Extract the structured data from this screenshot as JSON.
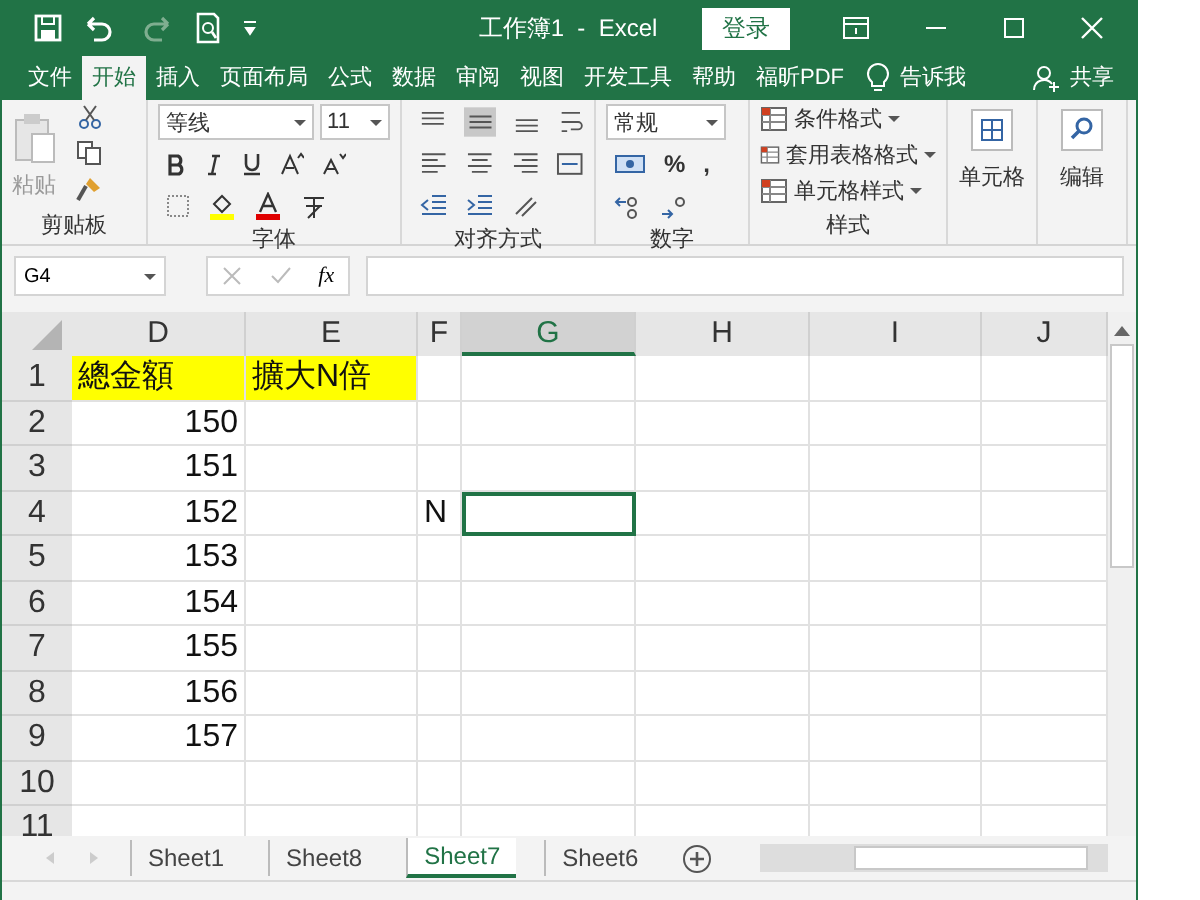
{
  "window": {
    "title": "工作簿1  -  Excel",
    "login": "登录"
  },
  "tabs": [
    {
      "label": "文件",
      "selected": false
    },
    {
      "label": "开始",
      "selected": true
    },
    {
      "label": "插入",
      "selected": false
    },
    {
      "label": "页面布局",
      "selected": false
    },
    {
      "label": "公式",
      "selected": false
    },
    {
      "label": "数据",
      "selected": false
    },
    {
      "label": "审阅",
      "selected": false
    },
    {
      "label": "视图",
      "selected": false
    },
    {
      "label": "开发工具",
      "selected": false
    },
    {
      "label": "帮助",
      "selected": false
    },
    {
      "label": "福昕PDF",
      "selected": false
    },
    {
      "label": "告诉我",
      "selected": false
    }
  ],
  "share": "共享",
  "ribbon": {
    "paste": "粘贴",
    "clipboard_group": "剪贴板",
    "font_name": "等线",
    "font_size": "11",
    "font_group": "字体",
    "align_group": "对齐方式",
    "number_format": "常规",
    "number_group": "数字",
    "percent": "%",
    "comma": ",",
    "styles": [
      "条件格式",
      "套用表格格式",
      "单元格样式"
    ],
    "styles_group": "样式",
    "cells": "单元格",
    "editing": "编辑"
  },
  "formula_bar": {
    "name_box": "G4",
    "fx": "fx"
  },
  "columns": [
    {
      "label": "D",
      "selected": false
    },
    {
      "label": "E",
      "selected": false
    },
    {
      "label": "F",
      "selected": false
    },
    {
      "label": "G",
      "selected": true
    },
    {
      "label": "H",
      "selected": false
    },
    {
      "label": "I",
      "selected": false
    },
    {
      "label": "J",
      "selected": false
    }
  ],
  "rows": [
    {
      "label": "1",
      "cells": [
        {
          "text": "總金額",
          "kind": "text",
          "highlighted": true,
          "selected": false
        },
        {
          "text": "擴大N倍",
          "kind": "text",
          "highlighted": true,
          "selected": false
        },
        {
          "selected": false
        },
        {
          "selected": false
        },
        {
          "selected": false
        },
        {
          "selected": false
        },
        {
          "selected": false
        }
      ]
    },
    {
      "label": "2",
      "cells": [
        {
          "text": "150",
          "kind": "number",
          "selected": false
        },
        {
          "selected": false
        },
        {
          "selected": false
        },
        {
          "selected": false
        },
        {
          "selected": false
        },
        {
          "selected": false
        },
        {
          "selected": false
        }
      ]
    },
    {
      "label": "3",
      "cells": [
        {
          "text": "151",
          "kind": "number",
          "selected": false
        },
        {
          "selected": false
        },
        {
          "selected": false
        },
        {
          "selected": false
        },
        {
          "selected": false
        },
        {
          "selected": false
        },
        {
          "selected": false
        }
      ]
    },
    {
      "label": "4",
      "cells": [
        {
          "text": "152",
          "kind": "number",
          "selected": false
        },
        {
          "selected": false
        },
        {
          "text": "N",
          "kind": "text",
          "selected": false
        },
        {
          "selected": true
        },
        {
          "selected": false
        },
        {
          "selected": false
        },
        {
          "selected": false
        }
      ]
    },
    {
      "label": "5",
      "cells": [
        {
          "text": "153",
          "kind": "number",
          "selected": false
        },
        {
          "selected": false
        },
        {
          "selected": false
        },
        {
          "selected": false
        },
        {
          "selected": false
        },
        {
          "selected": false
        },
        {
          "selected": false
        }
      ]
    },
    {
      "label": "6",
      "cells": [
        {
          "text": "154",
          "kind": "number",
          "selected": false
        },
        {
          "selected": false
        },
        {
          "selected": false
        },
        {
          "selected": false
        },
        {
          "selected": false
        },
        {
          "selected": false
        },
        {
          "selected": false
        }
      ]
    },
    {
      "label": "7",
      "cells": [
        {
          "text": "155",
          "kind": "number",
          "selected": false
        },
        {
          "selected": false
        },
        {
          "selected": false
        },
        {
          "selected": false
        },
        {
          "selected": false
        },
        {
          "selected": false
        },
        {
          "selected": false
        }
      ]
    },
    {
      "label": "8",
      "cells": [
        {
          "text": "156",
          "kind": "number",
          "selected": false
        },
        {
          "selected": false
        },
        {
          "selected": false
        },
        {
          "selected": false
        },
        {
          "selected": false
        },
        {
          "selected": false
        },
        {
          "selected": false
        }
      ]
    },
    {
      "label": "9",
      "cells": [
        {
          "text": "157",
          "kind": "number",
          "selected": false
        },
        {
          "selected": false
        },
        {
          "selected": false
        },
        {
          "selected": false
        },
        {
          "selected": false
        },
        {
          "selected": false
        },
        {
          "selected": false
        }
      ]
    },
    {
      "label": "10",
      "cells": [
        {
          "selected": false
        },
        {
          "selected": false
        },
        {
          "selected": false
        },
        {
          "selected": false
        },
        {
          "selected": false
        },
        {
          "selected": false
        },
        {
          "selected": false
        }
      ]
    },
    {
      "label": "11",
      "cells": [
        {
          "selected": false
        },
        {
          "selected": false
        },
        {
          "selected": false
        },
        {
          "selected": false
        },
        {
          "selected": false
        },
        {
          "selected": false
        },
        {
          "selected": false
        }
      ]
    }
  ],
  "sheets": [
    {
      "label": "Sheet1",
      "selected": false
    },
    {
      "label": "Sheet8",
      "selected": false
    },
    {
      "label": "Sheet7",
      "selected": true
    },
    {
      "label": "Sheet6",
      "selected": false
    }
  ]
}
